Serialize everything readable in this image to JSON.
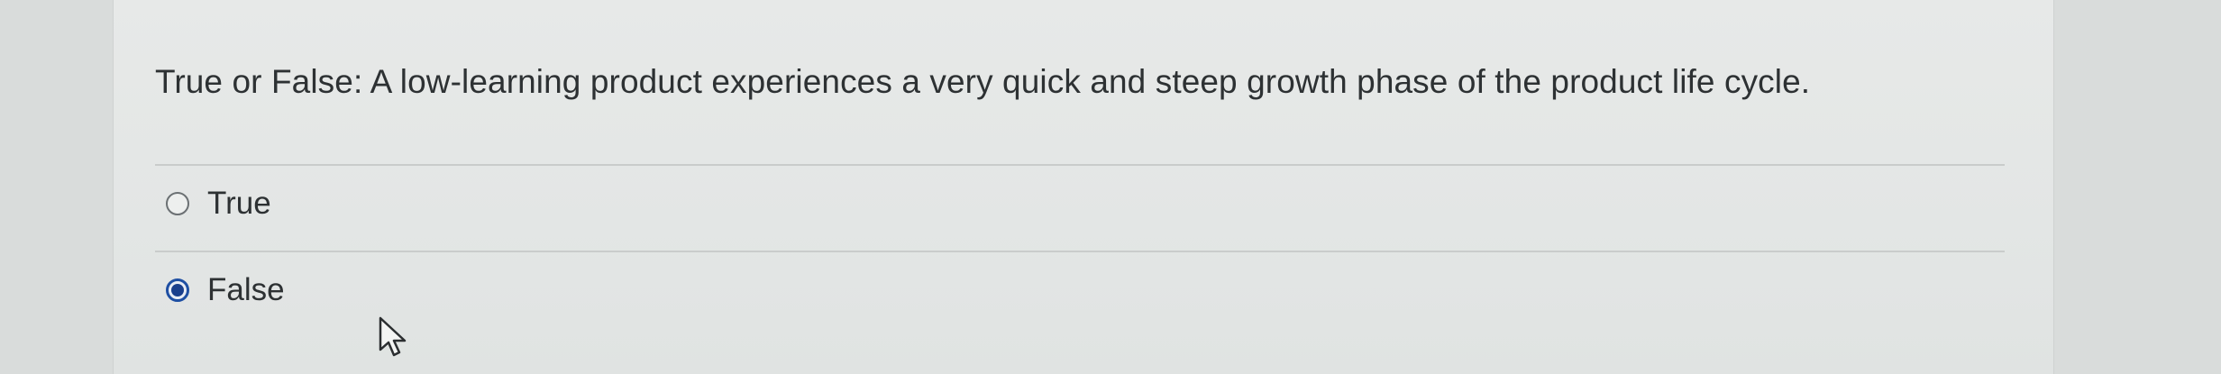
{
  "question": {
    "text": "True or False: A low-learning product experiences a very quick and steep growth phase of the product life cycle."
  },
  "options": [
    {
      "label": "True",
      "selected": false
    },
    {
      "label": "False",
      "selected": true
    }
  ],
  "colors": {
    "selected_radio": "#1a3f8c",
    "text": "#2d3133"
  },
  "icons": {
    "cursor": "mouse-pointer-icon"
  }
}
